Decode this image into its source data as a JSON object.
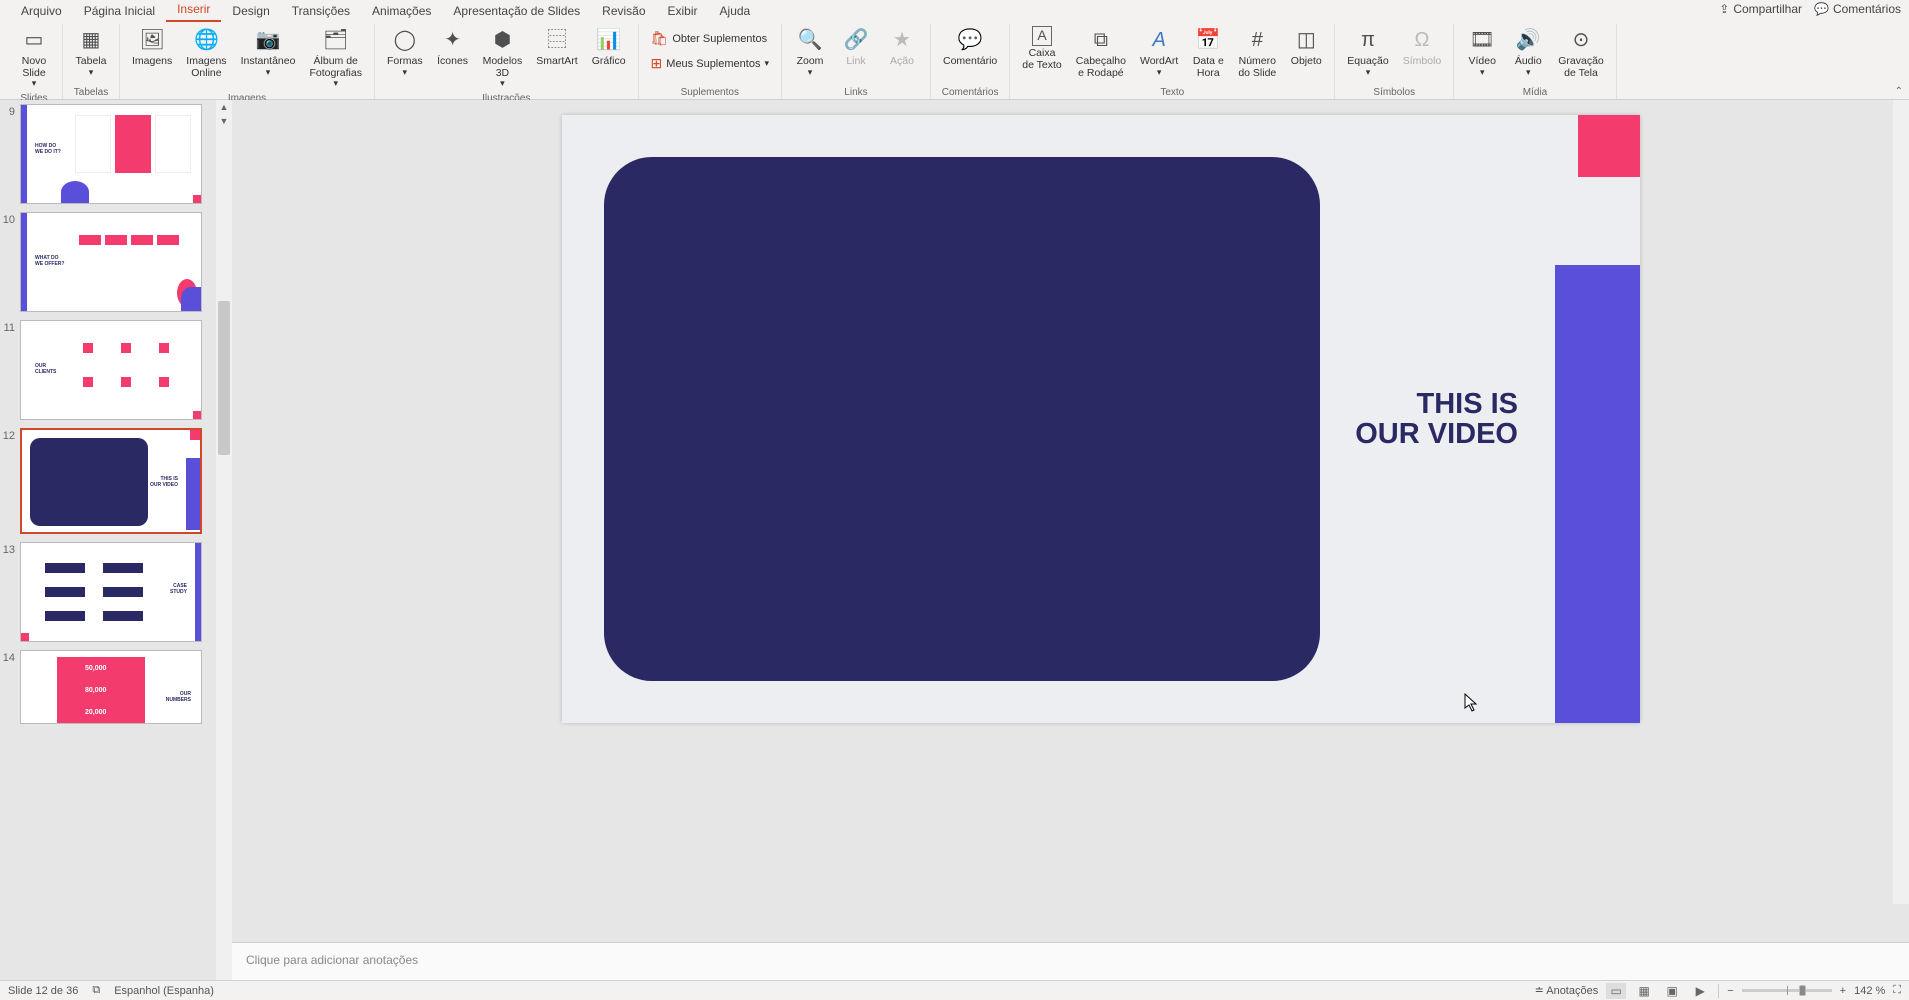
{
  "menu": {
    "tabs": [
      "Arquivo",
      "Página Inicial",
      "Inserir",
      "Design",
      "Transições",
      "Animações",
      "Apresentação de Slides",
      "Revisão",
      "Exibir",
      "Ajuda"
    ],
    "active": "Inserir",
    "share": "Compartilhar",
    "comments": "Comentários"
  },
  "ribbon": {
    "slides": {
      "label": "Slides",
      "new_slide": "Novo\nSlide"
    },
    "tables": {
      "label": "Tabelas",
      "table": "Tabela"
    },
    "images": {
      "label": "Imagens",
      "images": "Imagens",
      "images_online": "Imagens\nOnline",
      "screenshot": "Instantâneo",
      "album": "Álbum de\nFotografias"
    },
    "illustrations": {
      "label": "Ilustrações",
      "shapes": "Formas",
      "icons": "Ícones",
      "models_3d": "Modelos\n3D",
      "smartart": "SmartArt",
      "chart": "Gráfico"
    },
    "addins": {
      "label": "Suplementos",
      "get": "Obter Suplementos",
      "my": "Meus Suplementos"
    },
    "links": {
      "label": "Links",
      "zoom": "Zoom",
      "link": "Link",
      "action": "Ação"
    },
    "comments": {
      "label": "Comentários",
      "comment": "Comentário"
    },
    "text": {
      "label": "Texto",
      "textbox": "Caixa\nde Texto",
      "header_footer": "Cabeçalho\ne Rodapé",
      "wordart": "WordArt",
      "date_time": "Data e\nHora",
      "slide_number": "Número\ndo Slide",
      "object": "Objeto"
    },
    "symbols": {
      "label": "Símbolos",
      "equation": "Equação",
      "symbol": "Símbolo"
    },
    "media": {
      "label": "Mídia",
      "video": "Vídeo",
      "audio": "Áudio",
      "screen_recording": "Gravação\nde Tela"
    }
  },
  "slides_panel": {
    "numbers": [
      "9",
      "10",
      "11",
      "12",
      "13",
      "14"
    ],
    "active_index": 3
  },
  "slide": {
    "title_line1": "THIS IS",
    "title_line2": "OUR VIDEO"
  },
  "notes": {
    "placeholder": "Clique para adicionar anotações"
  },
  "status": {
    "slide_indicator": "Slide 12 de 36",
    "language": "Espanhol (Espanha)",
    "notes_btn": "Anotações",
    "zoom_pct": "142 %"
  },
  "thumb_text": {
    "t9": "HOW DO\nWE DO IT?",
    "t10": "WHAT DO\nWE OFFER?",
    "t11": "OUR\nCLIENTS",
    "t12": "THIS IS\nOUR VIDEO",
    "t13": "CASE\nSTUDY",
    "t14a": "50,000",
    "t14b": "80,000",
    "t14c": "20,000",
    "t14d": "OUR\nNUMBERS"
  }
}
